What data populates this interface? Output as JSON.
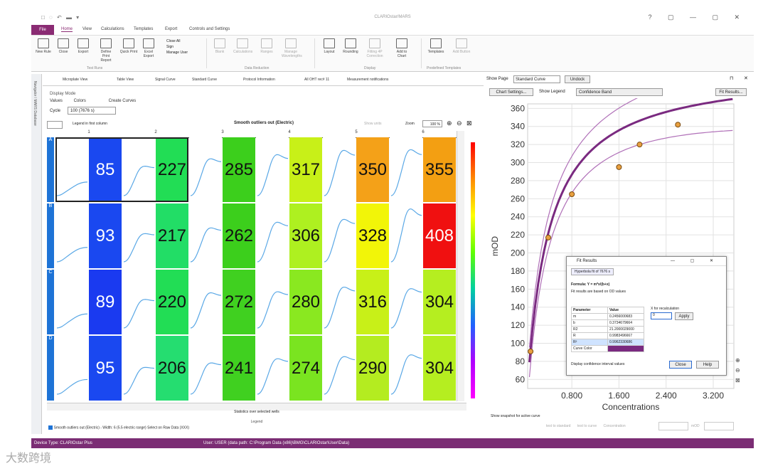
{
  "titlebar": {
    "title": "CLARIOstar/MARS",
    "controls": "? ▢ — ▢ ✕"
  },
  "menu": {
    "file": "File",
    "tabs": [
      "Home",
      "View",
      "Calculations",
      "Templates",
      "Export",
      "Controls and Settings"
    ]
  },
  "ribbon": {
    "buttons": [
      {
        "label": "New Rule",
        "disabled": false
      },
      {
        "label": "Close",
        "disabled": false
      },
      {
        "label": "Export",
        "disabled": false
      },
      {
        "label": "Define Print Report",
        "disabled": false
      },
      {
        "label": "Quick Print",
        "disabled": false
      },
      {
        "label": "Excel Export",
        "disabled": false
      }
    ],
    "close_items": [
      "Close All",
      "Sign",
      "Manage User"
    ],
    "analysis_buttons": [
      {
        "label": "Blank",
        "disabled": true
      },
      {
        "label": "Calculations",
        "disabled": true
      },
      {
        "label": "Ranges",
        "disabled": true
      },
      {
        "label": "Manage Wavelengths",
        "disabled": true
      }
    ],
    "display_buttons": [
      {
        "label": "Layout",
        "disabled": false
      },
      {
        "label": "Rounding",
        "disabled": false
      },
      {
        "label": "Fitting 4P Correction",
        "disabled": true
      },
      {
        "label": "Add to Chart",
        "disabled": false
      }
    ],
    "template_buttons": [
      {
        "label": "Templates",
        "disabled": false
      },
      {
        "label": "Add Button",
        "disabled": true
      }
    ],
    "groups": [
      "Test Runs",
      "Data Reduction",
      "Display",
      "Predefined Templates"
    ]
  },
  "nav": {
    "label": "Navigator / MARS Database"
  },
  "view_tabs": [
    "Microplate View",
    "Table View",
    "Signal Curve",
    "Standard Curve",
    "Protocol Information",
    "All OHT rec# 11",
    "Measurement notifications"
  ],
  "display": {
    "mode_label": "Display Mode",
    "modes": [
      "Values",
      "Colors",
      "Create Curves"
    ],
    "cycle_label": "Cycle",
    "cycle_value": "100 (7676 s)",
    "register_label": "Legend in first column",
    "plot_title": "Smooth outliers out (Electric)",
    "show_units": "Show units",
    "zoom_label": "Zoom",
    "zoom_value": "100 %"
  },
  "plate": {
    "columns": [
      "1",
      "2",
      "3",
      "4",
      "5",
      "6"
    ],
    "rows": [
      {
        "label": "A",
        "values": [
          85,
          227,
          285,
          317,
          350,
          355
        ],
        "colors": [
          "#1a48f0",
          "#22dd55",
          "#3ccf1c",
          "#c8f018",
          "#f4a118",
          "#f39f12"
        ]
      },
      {
        "label": "B",
        "values": [
          93,
          217,
          262,
          306,
          328,
          408
        ],
        "colors": [
          "#1a48f0",
          "#22dd66",
          "#3ccf1c",
          "#aef020",
          "#f2f508",
          "#f01010"
        ]
      },
      {
        "label": "C",
        "values": [
          89,
          220,
          272,
          280,
          316,
          304
        ],
        "colors": [
          "#1a3af0",
          "#22dd55",
          "#40d020",
          "#8ae820",
          "#c8f018",
          "#b5ee20"
        ]
      },
      {
        "label": "D",
        "values": [
          95,
          206,
          241,
          274,
          290,
          304
        ],
        "colors": [
          "#1a48f0",
          "#25dd70",
          "#40d020",
          "#7ae420",
          "#b4ec20",
          "#b5ee20"
        ]
      }
    ],
    "stat_text": "Statistics over selected wells",
    "legend_heading": "Legend",
    "legend_text": "Smooth outliers out (Electric) - Width: 6 (5.5 electric range) Select on Raw Data (XXX)"
  },
  "right_panel": {
    "show_page_label": "Show Page",
    "page_value": "Standard Curve",
    "undock": "Undock",
    "chart_settings": "Chart Settings...",
    "show_legend": "Show Legend",
    "band_value": "Confidence Band",
    "fit_results": "Fit Results...",
    "show_snapshot": "Show snapshot for active curve",
    "test_to_standard": "test to standard",
    "test_to_curve": "test to curve",
    "concentration_label": "Concentration",
    "mod_label": "mOD"
  },
  "chart_data": {
    "type": "scatter",
    "xlabel": "Concentrations",
    "ylabel": "mOD",
    "x_ticks": [
      "0.800",
      "1.600",
      "2.400",
      "3.200"
    ],
    "y_ticks": [
      60,
      80,
      100,
      120,
      140,
      160,
      180,
      200,
      220,
      240,
      260,
      280,
      300,
      320,
      340,
      360
    ],
    "xlim": [
      0.05,
      3.55
    ],
    "ylim": [
      50,
      365
    ],
    "points": [
      {
        "x": 0.1,
        "y": 91
      },
      {
        "x": 0.4,
        "y": 217
      },
      {
        "x": 0.8,
        "y": 265
      },
      {
        "x": 1.6,
        "y": 295
      },
      {
        "x": 1.95,
        "y": 320
      },
      {
        "x": 2.6,
        "y": 342
      }
    ],
    "grid": true,
    "curve_color": "#7a2a80",
    "point_color": "#e8a040"
  },
  "fit_dialog": {
    "title": "Fit Results",
    "tab": "Hyperbola fit of 7676 s",
    "formula": "Formula: Y = m*x/(b+x)",
    "note": "Fit results are based on OD values",
    "table_header": [
      "Parameter",
      "Value"
    ],
    "params": [
      [
        "m",
        "0.2456000683"
      ],
      [
        "b",
        "0.3734679664"
      ],
      [
        "R2",
        "21.2000029000"
      ],
      [
        "R",
        "0.9983496667"
      ],
      [
        "R²",
        "0.9962330686"
      ],
      [
        "Curve Color",
        ""
      ]
    ],
    "x_label": "X for recalculation",
    "x_value": "0",
    "apply": "Apply",
    "interval_label": "Display confidence interval values",
    "close": "Close",
    "help": "Help"
  },
  "status": {
    "device": "Device Type: CLARIOstar Plus",
    "user": "User: USER   (data path: C:\\Program Data (x86)\\BMG\\CLARIOstar\\User\\Data)"
  },
  "watermark": "大数跨境"
}
